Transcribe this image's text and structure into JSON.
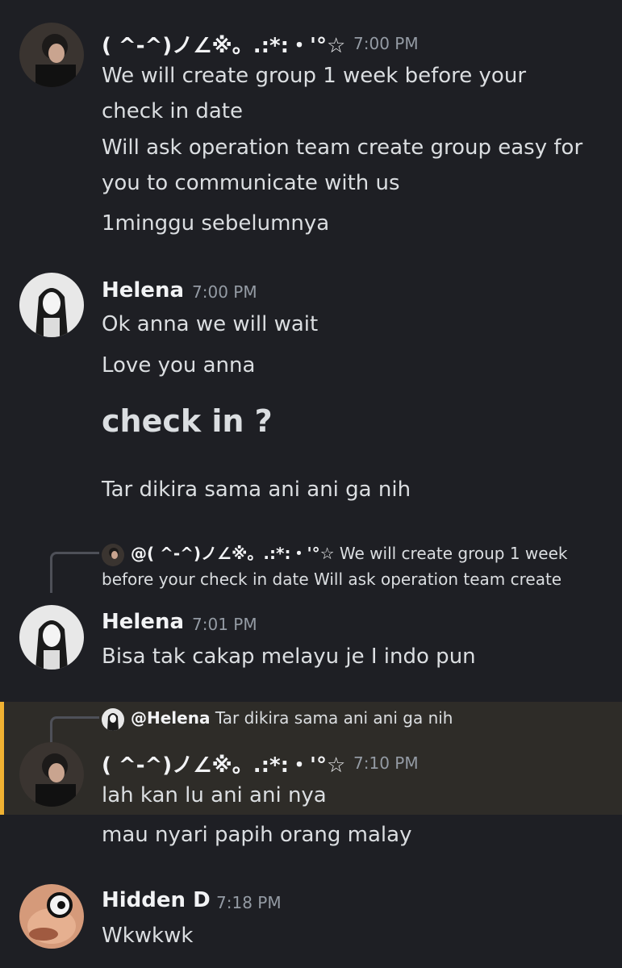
{
  "messages": [
    {
      "author": "( ^-^)ノ∠※。.:*:・'°☆",
      "time": "7:00 PM",
      "lines": [
        "We will create group 1 week before your",
        "check in date",
        "Will ask operation team create group easy for",
        "you to communicate with us",
        "1minggu sebelumnya"
      ]
    },
    {
      "author": "Helena",
      "time": "7:00 PM",
      "lines": [
        "Ok anna we will wait",
        "Love you anna"
      ],
      "big_line": "check in ?",
      "after_line": "Tar dikira sama ani ani ga nih"
    },
    {
      "reply": {
        "author": "@( ^-^)ノ∠※。.:*:・'°☆",
        "text_line1": "We will create group 1 week",
        "text_line2": "before your check in date  Will ask operation team create"
      },
      "author": "Helena",
      "time": "7:01 PM",
      "lines": [
        "Bisa tak cakap melayu je I indo pun"
      ]
    },
    {
      "reply": {
        "author": "@Helena",
        "text": "Tar dikira sama ani ani ga nih"
      },
      "author": "( ^-^)ノ∠※。.:*:・'°☆",
      "time": "7:10 PM",
      "lines": [
        "lah kan lu ani ani nya"
      ],
      "after_line": "mau nyari papih orang malay"
    },
    {
      "author": "Hidden D",
      "time": "7:18 PM",
      "lines": [
        "Wkwkwk"
      ]
    }
  ],
  "colors": {
    "background": "#1e1f24",
    "highlight": "#2e2c28",
    "highlight_bar": "#f0b232",
    "timestamp": "#949ba4"
  }
}
